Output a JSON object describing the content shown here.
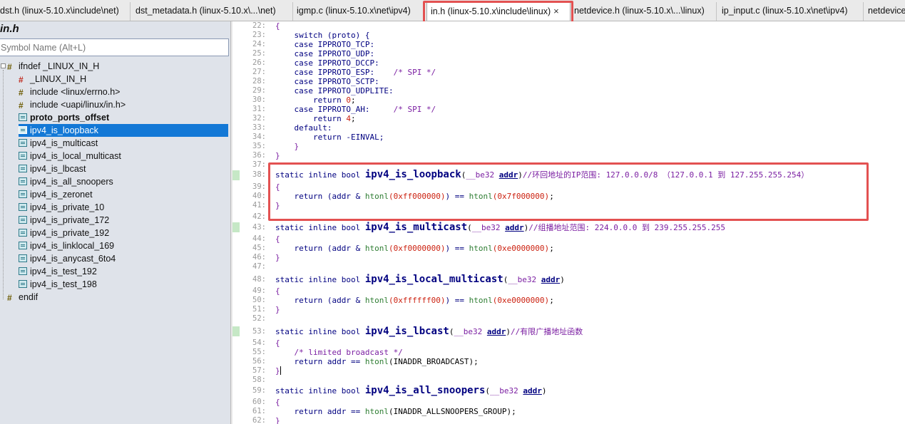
{
  "tabs": [
    {
      "label": "dst.h (linux-5.10.x\\include\\net)"
    },
    {
      "label": "dst_metadata.h (linux-5.10.x\\...\\net)"
    },
    {
      "label": "igmp.c (linux-5.10.x\\net\\ipv4)"
    },
    {
      "label": "in.h (linux-5.10.x\\include\\linux)",
      "close": "×"
    },
    {
      "label": "netdevice.h (linux-5.10.x\\...\\linux)"
    },
    {
      "label": "ip_input.c (linux-5.10.x\\net\\ipv4)"
    },
    {
      "label": "netdevice"
    }
  ],
  "panel": {
    "file_title": "in.h",
    "search_placeholder": "Symbol Name (Alt+L)",
    "tree": [
      {
        "label": "ifndef _LINUX_IN_H",
        "icon": "directive-icon"
      },
      {
        "label": "_LINUX_IN_H",
        "icon": "define-icon"
      },
      {
        "label": "include <linux/errno.h>",
        "icon": "directive-icon"
      },
      {
        "label": "include <uapi/linux/in.h>",
        "icon": "directive-icon"
      },
      {
        "label": "proto_ports_offset",
        "icon": "function-icon",
        "bold": true
      },
      {
        "label": "ipv4_is_loopback",
        "icon": "function-icon",
        "selected": true
      },
      {
        "label": "ipv4_is_multicast",
        "icon": "function-icon"
      },
      {
        "label": "ipv4_is_local_multicast",
        "icon": "function-icon"
      },
      {
        "label": "ipv4_is_lbcast",
        "icon": "function-icon"
      },
      {
        "label": "ipv4_is_all_snoopers",
        "icon": "function-icon"
      },
      {
        "label": "ipv4_is_zeronet",
        "icon": "function-icon"
      },
      {
        "label": "ipv4_is_private_10",
        "icon": "function-icon"
      },
      {
        "label": "ipv4_is_private_172",
        "icon": "function-icon"
      },
      {
        "label": "ipv4_is_private_192",
        "icon": "function-icon"
      },
      {
        "label": "ipv4_is_linklocal_169",
        "icon": "function-icon"
      },
      {
        "label": "ipv4_is_anycast_6to4",
        "icon": "function-icon"
      },
      {
        "label": "ipv4_is_test_192",
        "icon": "function-icon"
      },
      {
        "label": "ipv4_is_test_198",
        "icon": "function-icon"
      },
      {
        "label": "endif",
        "icon": "directive-icon"
      }
    ]
  },
  "code": {
    "line_numbers": [
      "22:",
      "23:",
      "24:",
      "25:",
      "26:",
      "27:",
      "28:",
      "29:",
      "30:",
      "31:",
      "32:",
      "33:",
      "34:",
      "35:",
      "36:",
      "37:",
      "38:",
      "39:",
      "40:",
      "41:",
      "42:",
      "43:",
      "44:",
      "45:",
      "46:",
      "47:",
      "48:",
      "49:",
      "50:",
      "51:",
      "52:",
      "53:",
      "54:",
      "55:",
      "56:",
      "57:",
      "58:",
      "59:",
      "60:",
      "61:",
      "62:"
    ],
    "text": {
      "l22": "{",
      "l23": "    switch (proto) {",
      "l24": "    case IPPROTO_TCP:",
      "l25": "    case IPPROTO_UDP:",
      "l26": "    case IPPROTO_DCCP:",
      "l27a": "    case IPPROTO_ESP:    ",
      "l27b": "/* SPI */",
      "l28": "    case IPPROTO_SCTP:",
      "l29": "    case IPPROTO_UDPLITE:",
      "l30a": "        return ",
      "l30b": "0",
      "l31a": "    case IPPROTO_AH:     ",
      "l31b": "/* SPI */",
      "l32a": "        return ",
      "l32b": "4",
      "l33": "    default:",
      "l34": "        return -EINVAL;",
      "l35": "    }",
      "l36": "}",
      "static_kw": "static inline bool ",
      "type_be32": "__be32",
      "param_addr": "addr",
      "fn38": "ipv4_is_loopback",
      "cm38": "//环回地址的IP范围: 127.0.0.0/8 （127.0.0.1 到 127.255.255.254）",
      "ret39a": "    return (addr & ",
      "call_htonl": "htonl",
      "h39a": "(0xff000000)",
      "h39b": "(0x7f000000)",
      "fn43": "ipv4_is_multicast",
      "cm43": "//组播地址范围: 224.0.0.0 到 239.255.255.255",
      "h45a": "(0xf0000000)",
      "h45b": "(0xe0000000)",
      "fn48": "ipv4_is_local_multicast",
      "h50a": "(0xffffff00)",
      "h50b": "(0xe0000000)",
      "fn53": "ipv4_is_lbcast",
      "cm53": "//有限广播地址函数",
      "cm55": "    /* limited broadcast */",
      "ret56a": "    return addr == ",
      "h56": "(INADDR_BROADCAST);",
      "fn59": "ipv4_is_all_snoopers",
      "h61": "(INADDR_ALLSNOOPERS_GROUP);",
      "eq": ") == ",
      "semi": ";",
      "open_brace": "{",
      "close_brace": "}",
      "lparen": "(",
      "rparen": ")",
      "space": " "
    }
  },
  "colors": {
    "highlight_border": "#e35151",
    "selection": "#1378d6",
    "keyword": "#000080",
    "comment": "#7b1fa2",
    "number": "#cc2211",
    "call": "#2e7d32"
  }
}
